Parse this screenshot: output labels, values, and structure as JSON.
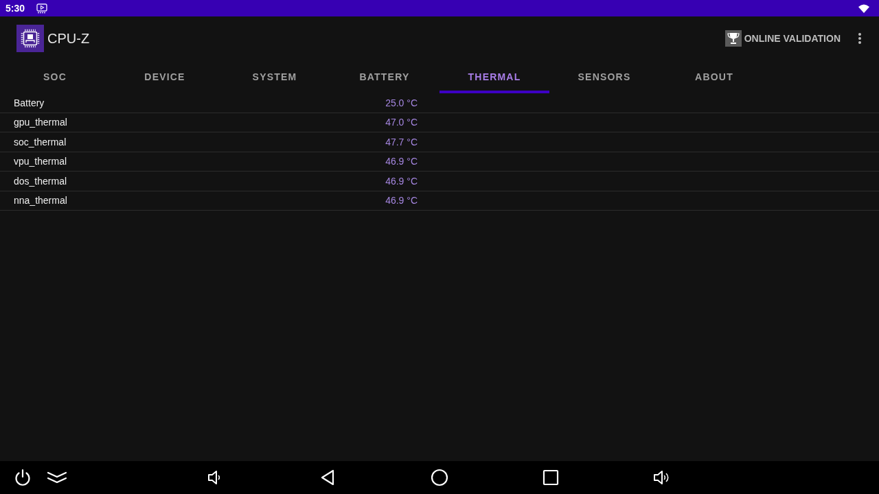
{
  "status_bar": {
    "time": "5:30"
  },
  "app_bar": {
    "title": "CPU-Z",
    "action": "ONLINE VALIDATION"
  },
  "tabs": [
    {
      "label": "SOC",
      "selected": false
    },
    {
      "label": "DEVICE",
      "selected": false
    },
    {
      "label": "SYSTEM",
      "selected": false
    },
    {
      "label": "BATTERY",
      "selected": false
    },
    {
      "label": "THERMAL",
      "selected": true
    },
    {
      "label": "SENSORS",
      "selected": false
    },
    {
      "label": "ABOUT",
      "selected": false
    }
  ],
  "rows": [
    {
      "name": "Battery",
      "value": "25.0 °C"
    },
    {
      "name": "gpu_thermal",
      "value": "47.0 °C"
    },
    {
      "name": "soc_thermal",
      "value": "47.7 °C"
    },
    {
      "name": "vpu_thermal",
      "value": "46.9 °C"
    },
    {
      "name": "dos_thermal",
      "value": "46.9 °C"
    },
    {
      "name": "nna_thermal",
      "value": "46.9 °C"
    }
  ]
}
